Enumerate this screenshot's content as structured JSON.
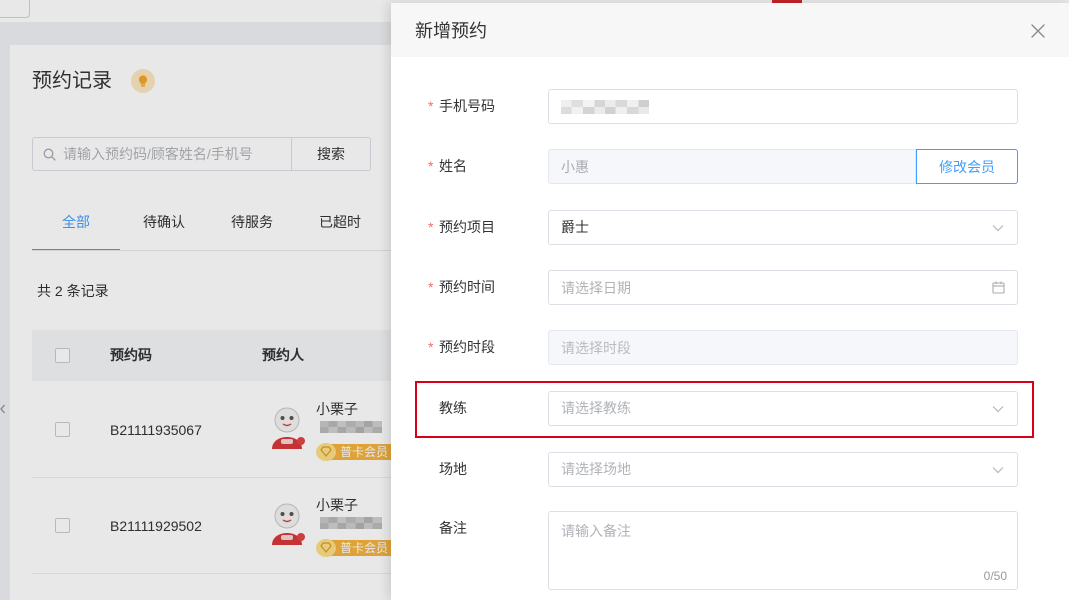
{
  "background_page": {
    "title": "预约记录",
    "search": {
      "placeholder": "请输入预约码/顾客姓名/手机号",
      "button_label": "搜索"
    },
    "tabs": [
      {
        "label": "全部",
        "active": true
      },
      {
        "label": "待确认",
        "active": false
      },
      {
        "label": "待服务",
        "active": false
      },
      {
        "label": "已超时",
        "active": false
      }
    ],
    "record_count": "共 2 条记录",
    "table": {
      "columns": [
        "预约码",
        "预约人"
      ],
      "rows": [
        {
          "code": "B21111935067",
          "name": "小栗子",
          "badge": "普卡会员"
        },
        {
          "code": "B21111929502",
          "name": "小栗子",
          "badge": "普卡会员"
        }
      ]
    }
  },
  "drawer": {
    "title": "新增预约",
    "required_mark": "*",
    "fields": {
      "phone": {
        "label": "手机号码"
      },
      "name": {
        "label": "姓名",
        "value": "小惠",
        "disabled": true,
        "action_label": "修改会员"
      },
      "project": {
        "label": "预约项目",
        "value": "爵士"
      },
      "date": {
        "label": "预约时间",
        "placeholder": "请选择日期"
      },
      "slot": {
        "label": "预约时段",
        "placeholder": "请选择时段",
        "disabled": true
      },
      "coach": {
        "label": "教练",
        "placeholder": "请选择教练",
        "highlighted": true
      },
      "venue": {
        "label": "场地",
        "placeholder": "请选择场地"
      },
      "remark": {
        "label": "备注",
        "placeholder": "请输入备注",
        "counter": "0/50"
      }
    }
  },
  "icons": {
    "hint": "lightbulb-icon",
    "search": "search-icon",
    "close": "close-icon",
    "select_arrow": "chevron-down-icon",
    "date_picker": "calendar-icon",
    "member_badge": "diamond-icon",
    "sidebar_toggle": "chevron-left-icon"
  },
  "colors": {
    "accent": "#409eff",
    "required": "#f56c6c",
    "highlight": "#d9001b",
    "badge": "#f4b23e",
    "overlay": "rgba(0,0,0,0.09)"
  }
}
